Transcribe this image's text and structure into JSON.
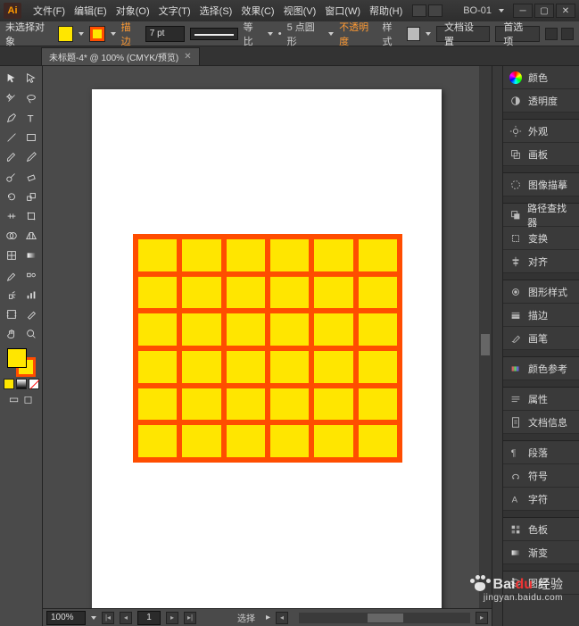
{
  "app_logo": "Ai",
  "menus": [
    "文件(F)",
    "编辑(E)",
    "对象(O)",
    "文字(T)",
    "选择(S)",
    "效果(C)",
    "视图(V)",
    "窗口(W)",
    "帮助(H)"
  ],
  "document_title": "BO-01",
  "control": {
    "selection_status": "未选择对象",
    "stroke_label": "描边",
    "stroke_weight": "7 pt",
    "profile_label": "等比",
    "brush_label": "5 点圆形",
    "opacity_label": "不透明度",
    "style_label": "样式",
    "doc_setup_btn": "文档设置",
    "preferences_btn": "首选项"
  },
  "tab": {
    "label": "未标题-4* @ 100% (CMYK/预览)"
  },
  "chart_data": {
    "type": "table",
    "description": "6x6 grid of yellow squares with orange stroke on white artboard",
    "rows": 6,
    "cols": 6,
    "fill_color": "#ffe600",
    "stroke_color": "#ff4d00"
  },
  "status": {
    "zoom": "100%",
    "page": "1",
    "tool_label": "选择"
  },
  "panels": [
    {
      "id": "color",
      "label": "颜色"
    },
    {
      "id": "transparency",
      "label": "透明度"
    },
    {
      "id": "appearance",
      "label": "外观"
    },
    {
      "id": "artboards",
      "label": "画板"
    },
    {
      "id": "image-trace",
      "label": "图像描摹"
    },
    {
      "id": "pathfinder",
      "label": "路径查找器"
    },
    {
      "id": "transform",
      "label": "变换"
    },
    {
      "id": "align",
      "label": "对齐"
    },
    {
      "id": "graphic-styles",
      "label": "图形样式"
    },
    {
      "id": "stroke",
      "label": "描边"
    },
    {
      "id": "brushes",
      "label": "画笔"
    },
    {
      "id": "color-guide",
      "label": "颜色参考"
    },
    {
      "id": "attributes",
      "label": "属性"
    },
    {
      "id": "document-info",
      "label": "文档信息"
    },
    {
      "id": "paragraph",
      "label": "段落"
    },
    {
      "id": "symbols",
      "label": "符号"
    },
    {
      "id": "character",
      "label": "字符"
    },
    {
      "id": "swatches",
      "label": "色板"
    },
    {
      "id": "gradient",
      "label": "渐变"
    },
    {
      "id": "layers",
      "label": "图层"
    }
  ],
  "watermark": {
    "brand_bai": "Bai",
    "brand_du": "du",
    "sub": "经验",
    "url": "jingyan.baidu.com"
  }
}
